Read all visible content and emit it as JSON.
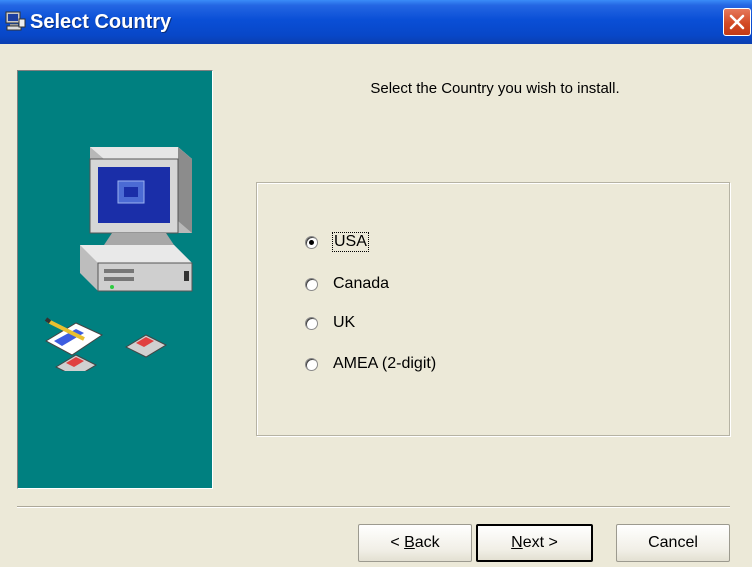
{
  "window": {
    "title": "Select Country"
  },
  "instruction": "Select the Country you wish to install.",
  "country_options": [
    {
      "label": "USA",
      "selected": true
    },
    {
      "label": "Canada",
      "selected": false
    },
    {
      "label": "UK",
      "selected": false
    },
    {
      "label": "AMEA (2-digit)",
      "selected": false
    }
  ],
  "buttons": {
    "back": {
      "prefix": "< ",
      "mnemonic": "B",
      "rest": "ack"
    },
    "next": {
      "mnemonic": "N",
      "rest": "ext >"
    },
    "cancel": "Cancel"
  },
  "colors": {
    "title_bar": "#0a4fd6",
    "side_panel": "#008080",
    "dialog_bg": "#ece9d8",
    "close_button": "#d34a25"
  },
  "icons": [
    "setup-app-icon",
    "close-icon",
    "computer-icon",
    "floppy-disk-icon",
    "document-pencil-icon"
  ]
}
